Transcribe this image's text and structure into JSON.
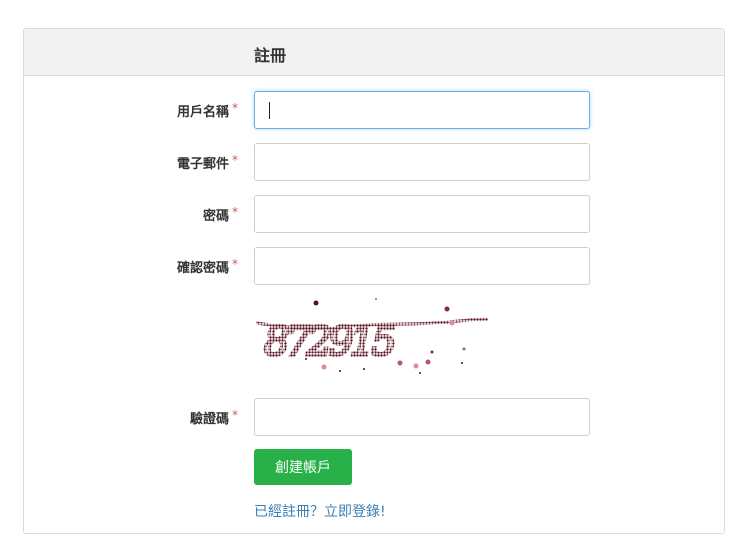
{
  "header": {
    "title": "註冊"
  },
  "form": {
    "username": {
      "label": "用戶名稱",
      "required_mark": "*",
      "value": ""
    },
    "email": {
      "label": "電子郵件",
      "required_mark": "*",
      "value": ""
    },
    "password": {
      "label": "密碼",
      "required_mark": "*",
      "value": ""
    },
    "confirm_password": {
      "label": "確認密碼",
      "required_mark": "*",
      "value": ""
    },
    "captcha": {
      "label": "驗證碼",
      "required_mark": "*",
      "value": "",
      "image_text": "872915"
    }
  },
  "actions": {
    "submit_label": "創建帳戶",
    "login_link_text": "已經註冊？立即登錄!"
  },
  "colors": {
    "submit": "#27b148",
    "link": "#3a7fb5",
    "required": "#d9534f",
    "focus": "#66afe9"
  }
}
